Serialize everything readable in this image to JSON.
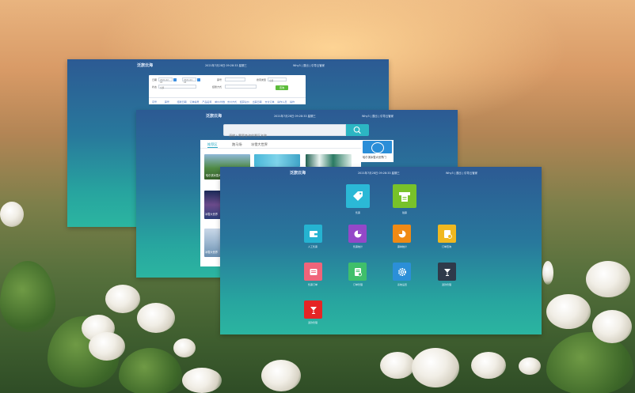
{
  "w1": {
    "title": "泛旅云海",
    "datetime": "2021年7月28日 09:28:33 星期三",
    "links": "Why3  | 退出  | 引导云管家",
    "form": {
      "label_date": "日期",
      "date_from": "2021-02-03",
      "date_to": "2021-02-03",
      "label_sort": "票号",
      "label_search": "搜索类型",
      "search_value": "全部",
      "label_status": "状态",
      "status_value": "全部",
      "label_paytype": "结账方式",
      "query_button": "查询"
    },
    "table_headers": [
      "序号",
      "票号",
      "结账日期",
      "订单编号",
      "产品名称",
      "单价/份数",
      "支付方式",
      "结算总价",
      "出票日期",
      "支付订单",
      "操作人员",
      "操作"
    ]
  },
  "w2": {
    "title": "泛旅云海",
    "datetime": "2021年7月28日 09:28:33 星期三",
    "links": "Why3  | 退出  | 引导云管家",
    "search_placeholder": "请输入需要查询的景区名称",
    "tabs": [
      "推荐区",
      "跑马场",
      "冰雪大世界"
    ],
    "captions": [
      "哈尔滨冰雪大世界门",
      "冰雪大世界",
      "冰雪大世界"
    ],
    "side_badge_text": "哈尔滨冰雪大世界门"
  },
  "w3": {
    "title": "泛旅云海",
    "datetime": "2021年7月28日 09:28:33 星期三",
    "links": "Why3  | 退出  | 引导云管家",
    "tiles": [
      {
        "label": "售票"
      },
      {
        "label": "验票"
      },
      {
        "label": "人工售票"
      },
      {
        "label": "售票统计"
      },
      {
        "label": "票种统计"
      },
      {
        "label": "订单查询"
      },
      {
        "label": "售票订单"
      },
      {
        "label": "订单管理"
      },
      {
        "label": "系统设置"
      },
      {
        "label": "退款管理"
      },
      {
        "label": "退款管理"
      }
    ],
    "colors": {
      "ticket": "#2bb8d6",
      "verify": "#78c22a",
      "manual": "#25b3d1",
      "stats": "#9448c8",
      "types": "#f08a14",
      "orders": "#f0b820",
      "sale_orders": "#f0647a",
      "manage": "#3fbf6b",
      "settings": "#2b8fd8",
      "refund": "#2f3a4a",
      "refund2": "#e52525"
    }
  }
}
